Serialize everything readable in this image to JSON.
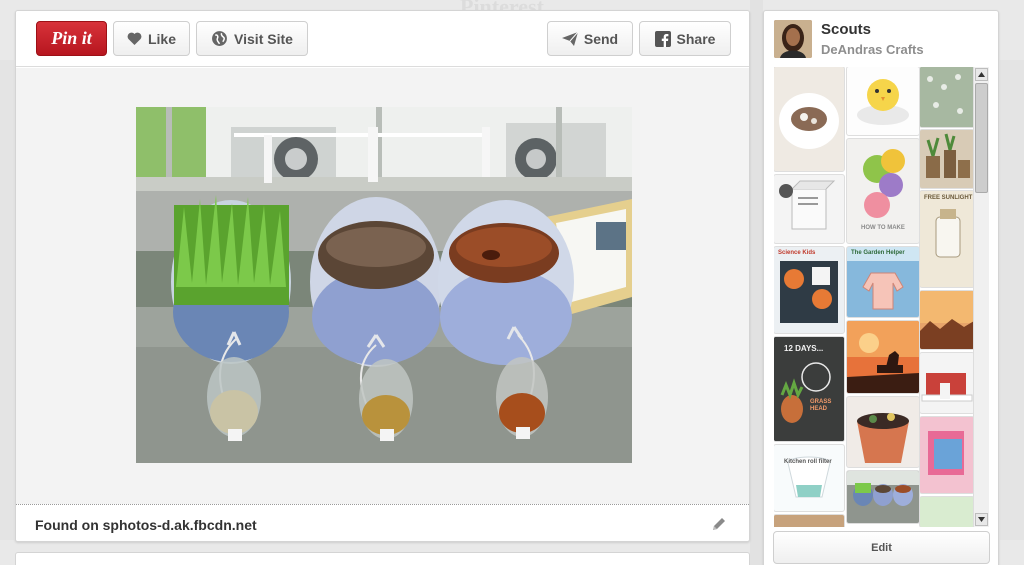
{
  "background": {
    "site_word": "Pinterest"
  },
  "toolbar": {
    "pin_label": "Pin it",
    "like_label": "Like",
    "visit_label": "Visit Site",
    "send_label": "Send",
    "share_label": "Share"
  },
  "footer": {
    "found_text": "Found on sphotos-d.ak.fbcdn.net"
  },
  "sidebar": {
    "board_title": "Scouts",
    "board_owner": "DeAndras Crafts",
    "edit_label": "Edit",
    "thumb_labels": {
      "science": "Science Kids",
      "garden": "The Garden Helper",
      "days": "12 DAYS...",
      "grass": "GRASS HEAD",
      "kitchen": "Kitchen roll filter",
      "how_to": "HOW TO MAKE",
      "free": "FREE SUNLIGHT"
    }
  },
  "colors": {
    "pin_red": "#cb2027",
    "owner_gray": "#8e8e8e"
  },
  "icons": {
    "like": "heart-icon",
    "visit": "globe-icon",
    "send": "paper-plane-icon",
    "share": "facebook-icon",
    "edit_source": "pencil-icon"
  }
}
